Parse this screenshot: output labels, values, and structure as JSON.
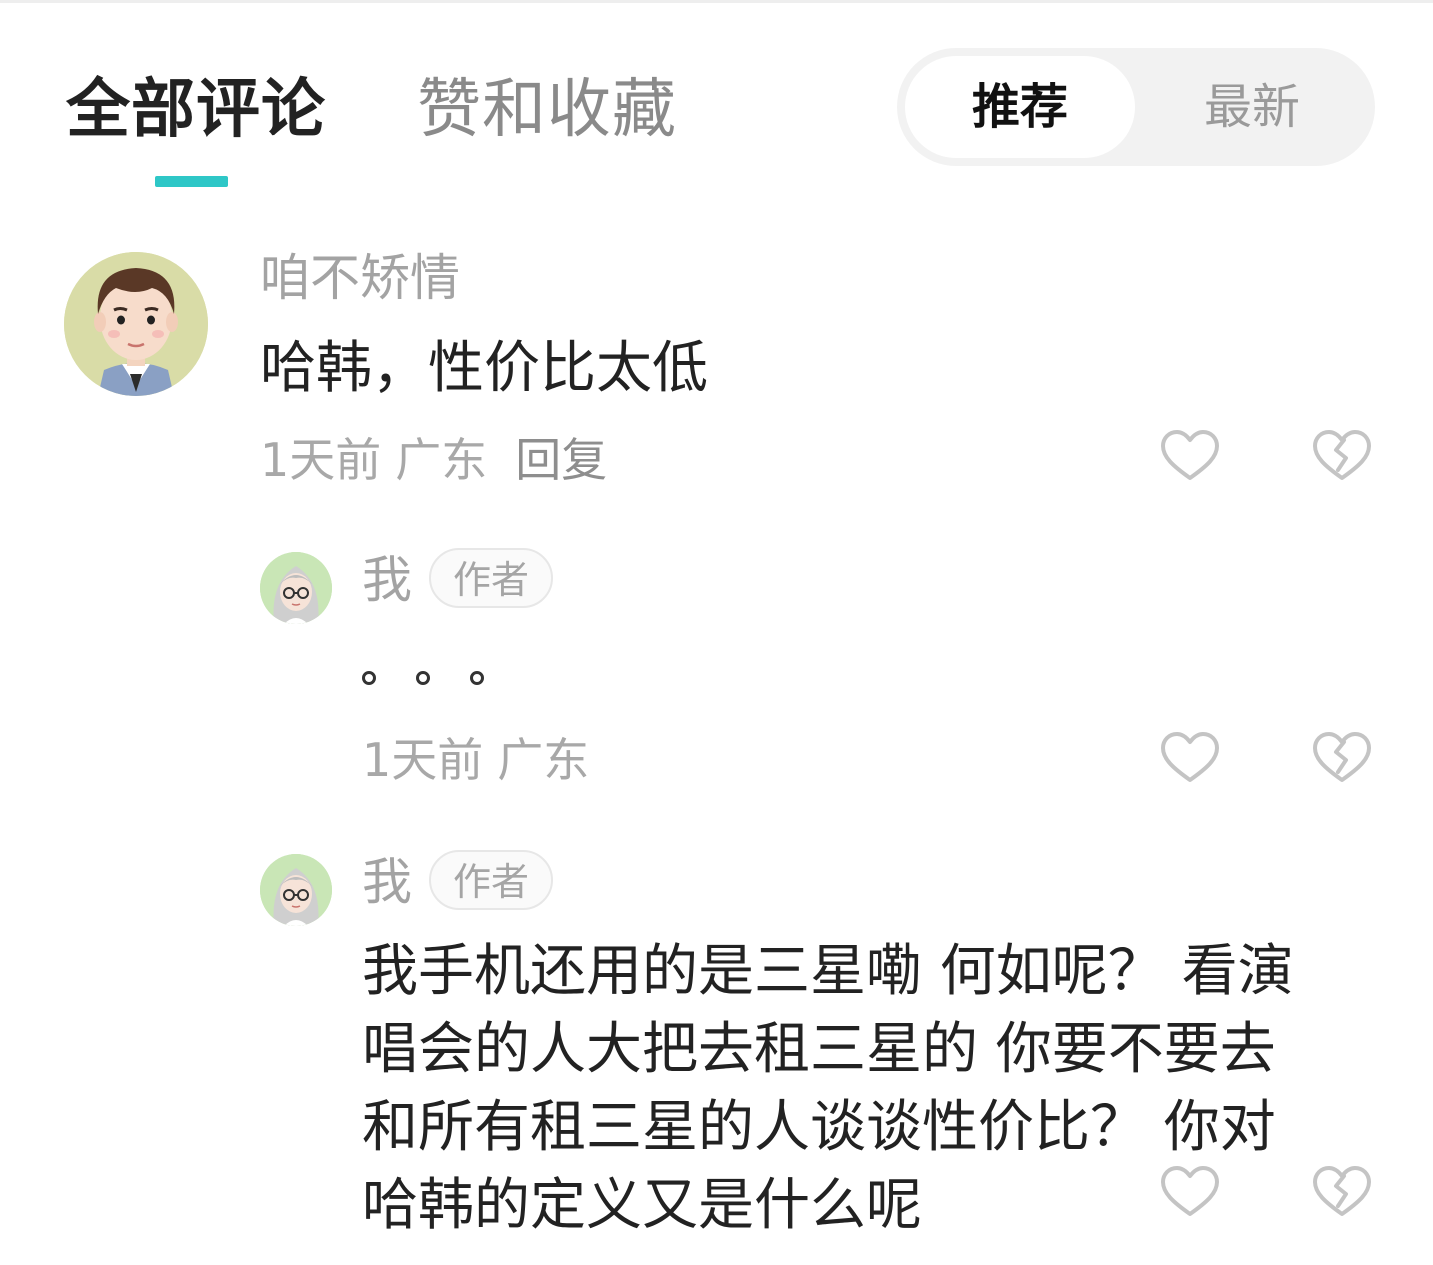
{
  "tabs": {
    "all_comments": "全部评论",
    "likes_and_favorites": "赞和收藏"
  },
  "sort": {
    "recommended": "推荐",
    "latest": "最新"
  },
  "comments": [
    {
      "username": "咱不矫情",
      "text": "哈韩，性价比太低",
      "time": "1天前",
      "location": "广东",
      "reply": "回复",
      "replies": [
        {
          "username": "我",
          "badge": "作者",
          "time": "1天前",
          "location": "广东"
        },
        {
          "username": "我",
          "badge": "作者",
          "text": "我手机还用的是三星嘞 何如呢？ 看演\n唱会的人大把去租三星的 你要不要去\n和所有租三星的人谈谈性价比？ 你对\n哈韩的定义又是什么呢"
        }
      ]
    }
  ],
  "icons": {
    "like": "heart-outline-icon",
    "dislike": "broken-heart-icon"
  },
  "colors": {
    "accent": "#2ec7c7",
    "icon_gray": "#c4c4c4"
  }
}
